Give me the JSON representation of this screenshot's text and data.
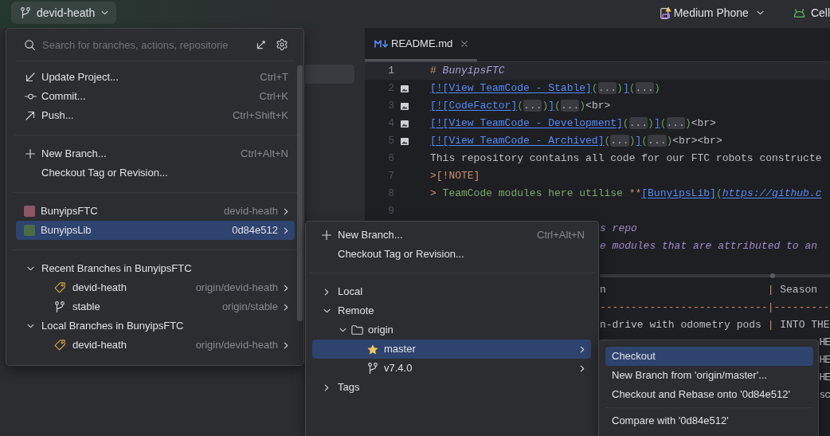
{
  "toolbar": {
    "branch": "devid-heath",
    "device": "Medium Phone",
    "run_configuration": "Cell"
  },
  "project_panel": {
    "highlighted_row": true
  },
  "editor": {
    "tab": {
      "label": "README.md",
      "selected": true
    },
    "lines": [
      {
        "number": "1",
        "image": false,
        "current": true,
        "tokens": [
          {
            "kind": "heading_mark",
            "text": "#"
          },
          {
            "kind": "heading",
            "text": " BunyipsFTC"
          }
        ]
      },
      {
        "number": "2",
        "image": true,
        "current": false,
        "tokens": [
          {
            "kind": "link",
            "text": "[![View TeamCode - Stable]"
          },
          {
            "kind": "paren",
            "text": "("
          },
          {
            "kind": "fold",
            "text": "..."
          },
          {
            "kind": "paren",
            "text": ")"
          },
          {
            "kind": "link",
            "text": "]"
          },
          {
            "kind": "paren",
            "text": "("
          },
          {
            "kind": "fold",
            "text": "..."
          },
          {
            "kind": "paren",
            "text": ")"
          }
        ]
      },
      {
        "number": "3",
        "image": true,
        "current": false,
        "tokens": [
          {
            "kind": "link",
            "text": "[![CodeFactor]"
          },
          {
            "kind": "paren",
            "text": "("
          },
          {
            "kind": "fold",
            "text": "..."
          },
          {
            "kind": "paren",
            "text": ")"
          },
          {
            "kind": "link",
            "text": "]"
          },
          {
            "kind": "paren",
            "text": "("
          },
          {
            "kind": "fold",
            "text": "..."
          },
          {
            "kind": "paren",
            "text": ")"
          },
          {
            "kind": "plain",
            "text": "<br>"
          }
        ]
      },
      {
        "number": "4",
        "image": true,
        "current": false,
        "tokens": [
          {
            "kind": "link",
            "text": "[![View TeamCode - Development]"
          },
          {
            "kind": "paren",
            "text": "("
          },
          {
            "kind": "fold",
            "text": "..."
          },
          {
            "kind": "paren",
            "text": ")"
          },
          {
            "kind": "link",
            "text": "]"
          },
          {
            "kind": "paren",
            "text": "("
          },
          {
            "kind": "fold",
            "text": "..."
          },
          {
            "kind": "paren",
            "text": ")"
          },
          {
            "kind": "plain",
            "text": "<br>"
          }
        ]
      },
      {
        "number": "5",
        "image": true,
        "current": false,
        "tokens": [
          {
            "kind": "link",
            "text": "[![View TeamCode - Archived]"
          },
          {
            "kind": "paren",
            "text": "("
          },
          {
            "kind": "fold",
            "text": "..."
          },
          {
            "kind": "paren",
            "text": ")"
          },
          {
            "kind": "link",
            "text": "]"
          },
          {
            "kind": "paren",
            "text": "("
          },
          {
            "kind": "fold",
            "text": "..."
          },
          {
            "kind": "paren",
            "text": ")"
          },
          {
            "kind": "plain",
            "text": "<br><br>"
          }
        ]
      },
      {
        "number": "6",
        "image": false,
        "current": false,
        "tokens": [
          {
            "kind": "plain",
            "text": "This repository contains all code for our FTC robots constructe"
          }
        ]
      },
      {
        "number": "7",
        "image": false,
        "current": false,
        "tokens": [
          {
            "kind": "note",
            "text": ">[!NOTE]"
          }
        ]
      },
      {
        "number": "8",
        "image": false,
        "current": false,
        "tokens": [
          {
            "kind": "quote_mark",
            "text": "> "
          },
          {
            "kind": "quote",
            "text": "TeamCode modules here utilise "
          },
          {
            "kind": "bold_mark",
            "text": "**"
          },
          {
            "kind": "link",
            "text": "[BunyipsLib]"
          },
          {
            "kind": "paren",
            "text": "("
          },
          {
            "kind": "url",
            "text": "https://github.c"
          }
        ]
      },
      {
        "number": "9",
        "image": false,
        "current": false
      }
    ],
    "comment_lines": [
      {
        "tokens": [
          {
            "kind": "comment",
            "text": "s repo"
          }
        ]
      },
      {
        "tokens": [
          {
            "kind": "comment",
            "text": "e modules that are attributed to an"
          }
        ]
      }
    ],
    "table_lines": [
      {
        "tokens": [
          {
            "kind": "plain",
            "text": "n                          "
          },
          {
            "kind": "pipe",
            "text": "|"
          },
          {
            "kind": "plain",
            "text": " Season"
          }
        ]
      },
      {
        "tokens": [
          {
            "kind": "rule",
            "text": "---------------------------"
          },
          {
            "kind": "pipe",
            "text": "|"
          },
          {
            "kind": "rule",
            "text": "---------"
          }
        ]
      },
      {
        "tokens": [
          {
            "kind": "plain",
            "text": "n-drive with odometry pods "
          },
          {
            "kind": "pipe",
            "text": "|"
          },
          {
            "kind": "plain",
            "text": " INTO THE"
          }
        ]
      }
    ],
    "edge_fragments": [
      "HE",
      "HE",
      "HE",
      "sc"
    ]
  },
  "branch_popup": {
    "search": {
      "placeholder": "Search for branches, actions, repositorie"
    },
    "action_groups": [
      {
        "items": [
          {
            "kind": "update",
            "label": "Update Project...",
            "shortcut": "Ctrl+T"
          },
          {
            "kind": "commit",
            "label": "Commit...",
            "shortcut": "Ctrl+K"
          },
          {
            "kind": "push",
            "label": "Push...",
            "shortcut": "Ctrl+Shift+K"
          }
        ]
      },
      {
        "items": [
          {
            "kind": "new",
            "label": "New Branch...",
            "shortcut": "Ctrl+Alt+N"
          },
          {
            "kind": "plain",
            "label": "Checkout Tag or Revision..."
          }
        ]
      }
    ],
    "repositories": [
      {
        "name": "BunyipsFTC",
        "branch": "devid-heath",
        "color": "#8e5565",
        "selected": false
      },
      {
        "name": "BunyipsLib",
        "branch": "0d84e512",
        "color": "#4b6b45",
        "selected": true
      }
    ],
    "branch_groups": [
      {
        "title": "Recent Branches in BunyipsFTC",
        "expanded": true,
        "branches": [
          {
            "kind": "tag",
            "name": "devid-heath",
            "tracking": "origin/devid-heath"
          },
          {
            "kind": "branch",
            "name": "stable",
            "tracking": "origin/stable"
          }
        ]
      },
      {
        "title": "Local Branches in BunyipsFTC",
        "expanded": true,
        "branches": [
          {
            "kind": "tag",
            "name": "devid-heath",
            "tracking": "origin/devid-heath"
          }
        ]
      }
    ]
  },
  "repo_submenu": {
    "actions": [
      {
        "kind": "new",
        "label": "New Branch...",
        "shortcut": "Ctrl+Alt+N"
      },
      {
        "kind": "plain",
        "label": "Checkout Tag or Revision..."
      }
    ],
    "tree": [
      {
        "kind": "group",
        "label": "Local",
        "expanded": false,
        "selected": false
      },
      {
        "kind": "group",
        "label": "Remote",
        "expanded": true,
        "selected": false,
        "children": [
          {
            "kind": "folder",
            "label": "origin",
            "expanded": true,
            "selected": false,
            "children": [
              {
                "kind": "star",
                "label": "master",
                "selected": true
              },
              {
                "kind": "branch",
                "label": "v7.4.0",
                "selected": false
              }
            ]
          }
        ]
      },
      {
        "kind": "group",
        "label": "Tags",
        "expanded": false,
        "selected": false
      }
    ]
  },
  "branch_submenu": {
    "groups": [
      {
        "items": [
          {
            "label": "Checkout",
            "selected": true
          },
          {
            "label": "New Branch from 'origin/master'...",
            "selected": false
          },
          {
            "label": "Checkout and Rebase onto '0d84e512'",
            "selected": false
          }
        ]
      },
      {
        "items": [
          {
            "label": "Compare with '0d84e512'",
            "selected": false
          }
        ]
      }
    ]
  }
}
